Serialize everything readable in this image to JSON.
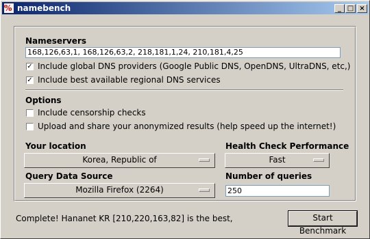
{
  "window": {
    "title": "namebench",
    "icon_glyph": "%",
    "min_glyph": "_",
    "max_glyph": "□",
    "close_glyph": "×"
  },
  "nameservers": {
    "heading": "Nameservers",
    "value": "168,126,63,1, 168,126,63,2, 218,181,1,24, 210,181,4,25",
    "include_global_label": "Include global DNS providers (Google Public DNS, OpenDNS, UltraDNS, etc,)",
    "include_global_checked": true,
    "include_regional_label": "Include best available regional DNS services",
    "include_regional_checked": true
  },
  "options": {
    "heading": "Options",
    "censorship_label": "Include censorship checks",
    "censorship_checked": false,
    "upload_label": "Upload and share your anonymized results (help speed up the internet!)",
    "upload_checked": false
  },
  "location": {
    "label": "Your location",
    "value": "Korea, Republic of"
  },
  "health": {
    "label": "Health Check Performance",
    "value": "Fast"
  },
  "query_source": {
    "label": "Query Data Source",
    "value": "Mozilla Firefox (2264)"
  },
  "queries": {
    "label": "Number of queries",
    "value": "250"
  },
  "status_text": "Complete! Hananet KR [210,220,163,82] is the best,",
  "start_button_label": "Start Benchmark",
  "check_glyph": "✓"
}
